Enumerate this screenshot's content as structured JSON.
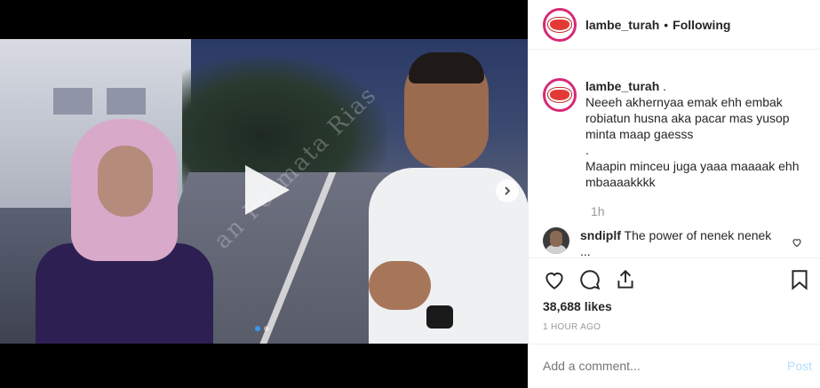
{
  "media": {
    "watermark": "an Permata Rias",
    "play_icon": "play-icon",
    "next_icon": "chevron-right-icon",
    "dots": 2
  },
  "header": {
    "username": "lambe_turah",
    "separator": "•",
    "follow_status": "Following"
  },
  "caption": {
    "username": "lambe_turah",
    "lines": [
      ".",
      "Neeeh akhernyaa emak ehh embak",
      "robiatun husna aka pacar mas yusop",
      "minta maap gaesss",
      ".",
      "Maapin minceu juga yaaa maaaak ehh",
      "mbaaaakkkk"
    ],
    "time": "1h"
  },
  "comment": {
    "username": "sndiplf",
    "text": "The power of nenek nenek",
    "more": "..."
  },
  "actions": {
    "like_icon": "heart-icon",
    "comment_icon": "comment-icon",
    "share_icon": "share-icon",
    "save_icon": "bookmark-icon"
  },
  "likes": "38,688 likes",
  "time_ago": "1 HOUR AGO",
  "add_comment": {
    "placeholder": "Add a comment...",
    "post_label": "Post"
  },
  "colors": {
    "accent": "#3897f0",
    "post_disabled": "#b2dffc",
    "avatar_ring": "#d62976"
  }
}
